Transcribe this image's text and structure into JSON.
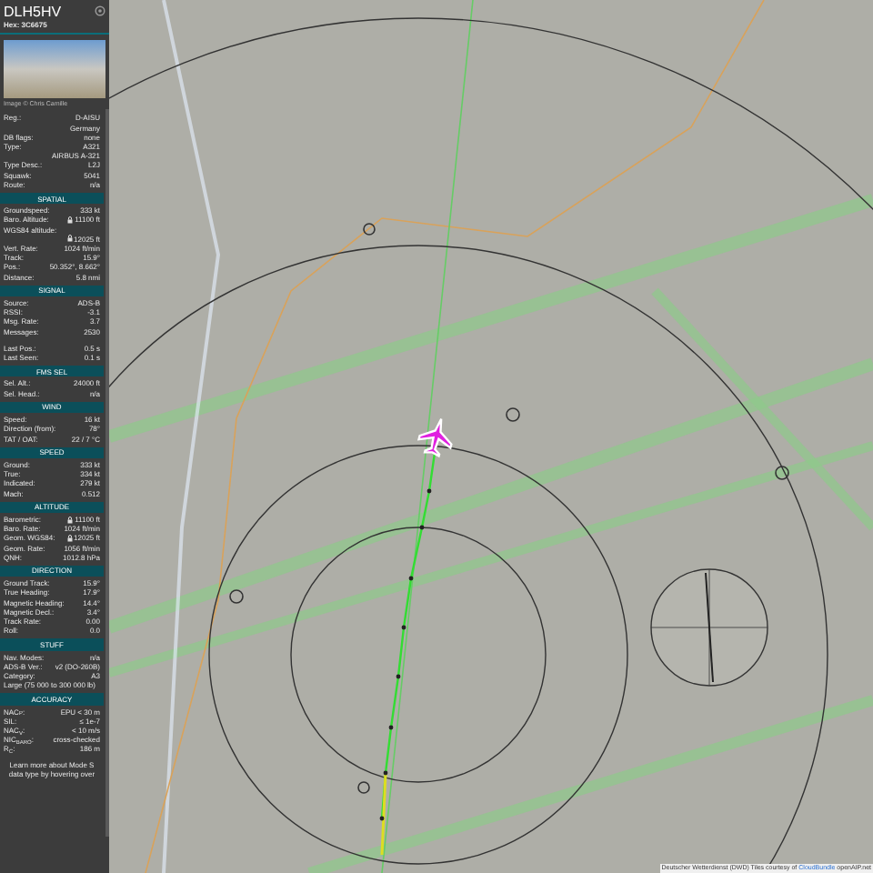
{
  "aircraft": {
    "callsign": "DLH5HV",
    "hex": "Hex: 3C6675",
    "photo_credit": "Image © Chris Camille"
  },
  "sections": [
    {
      "rows": [
        {
          "kind": "row",
          "label": "Reg.:",
          "values": [
            "D-AISU",
            "Germany"
          ]
        },
        {
          "kind": "row",
          "label": "DB flags:",
          "values": [
            "none"
          ]
        },
        {
          "kind": "row",
          "label": "Type:",
          "values": [
            "A321",
            "AIRBUS A-321"
          ]
        },
        {
          "kind": "row",
          "label": "Type Desc.:",
          "values": [
            "L2J"
          ]
        },
        {
          "kind": "row",
          "label": "Squawk:",
          "values": [
            "5041"
          ]
        },
        {
          "kind": "row",
          "label": "Route:",
          "values": [
            "n/a"
          ]
        }
      ]
    },
    {
      "title": "SPATIAL",
      "rows": [
        {
          "kind": "row",
          "label": "Groundspeed:",
          "values": [
            "333 kt"
          ]
        },
        {
          "kind": "row",
          "label": "Baro. Altitude:",
          "values": [
            "11100 ft"
          ],
          "locked": true
        },
        {
          "kind": "wrapped",
          "label": "WGS84 altitude:",
          "values": [
            "12025 ft"
          ],
          "locked": true
        },
        {
          "kind": "row",
          "label": "Vert. Rate:",
          "values": [
            "1024 ft/min"
          ]
        },
        {
          "kind": "row",
          "label": "Track:",
          "values": [
            "15.9°"
          ]
        },
        {
          "kind": "row",
          "label": "Pos.:",
          "values": [
            "50.352°, 8.662°"
          ]
        },
        {
          "kind": "row",
          "label": "Distance:",
          "values": [
            "5.8 nmi"
          ]
        }
      ]
    },
    {
      "title": "SIGNAL",
      "rows": [
        {
          "kind": "row",
          "label": "Source:",
          "values": [
            "ADS-B"
          ]
        },
        {
          "kind": "row",
          "label": "RSSI:",
          "values": [
            "-3.1"
          ]
        },
        {
          "kind": "row",
          "label": "Msg. Rate:",
          "values": [
            "3.7"
          ]
        },
        {
          "kind": "row",
          "label": "Messages:",
          "values": [
            "2530"
          ]
        },
        {
          "kind": "gap"
        },
        {
          "kind": "row",
          "label": "Last Pos.:",
          "values": [
            "0.5 s"
          ]
        },
        {
          "kind": "row",
          "label": "Last Seen:",
          "values": [
            "0.1 s"
          ]
        }
      ]
    },
    {
      "title": "FMS SEL",
      "rows": [
        {
          "kind": "row",
          "label": "Sel. Alt.:",
          "values": [
            "24000 ft"
          ]
        },
        {
          "kind": "row",
          "label": "Sel. Head.:",
          "values": [
            "n/a"
          ]
        }
      ]
    },
    {
      "title": "WIND",
      "rows": [
        {
          "kind": "row",
          "label": "Speed:",
          "values": [
            "16 kt"
          ]
        },
        {
          "kind": "row",
          "label": "Direction (from):",
          "values": [
            "78°"
          ]
        },
        {
          "kind": "row",
          "label": "TAT / OAT:",
          "values": [
            "22 / 7 °C"
          ]
        }
      ]
    },
    {
      "title": "SPEED",
      "rows": [
        {
          "kind": "row",
          "label": "Ground:",
          "values": [
            "333 kt"
          ]
        },
        {
          "kind": "row",
          "label": "True:",
          "values": [
            "334 kt"
          ]
        },
        {
          "kind": "row",
          "label": "Indicated:",
          "values": [
            "279 kt"
          ]
        },
        {
          "kind": "row",
          "label": "Mach:",
          "values": [
            "0.512"
          ]
        }
      ]
    },
    {
      "title": "ALTITUDE",
      "rows": [
        {
          "kind": "row",
          "label": "Barometric:",
          "values": [
            "11100 ft"
          ],
          "locked": true
        },
        {
          "kind": "row",
          "label": "Baro. Rate:",
          "values": [
            "1024 ft/min"
          ]
        },
        {
          "kind": "row",
          "label": "Geom. WGS84:",
          "values": [
            "12025 ft"
          ],
          "locked": true
        },
        {
          "kind": "row",
          "label": "Geom. Rate:",
          "values": [
            "1056 ft/min"
          ]
        },
        {
          "kind": "row",
          "label": "QNH:",
          "values": [
            "1012.8 hPa"
          ]
        }
      ]
    },
    {
      "title": "DIRECTION",
      "rows": [
        {
          "kind": "row",
          "label": "Ground Track:",
          "values": [
            "15.9°"
          ]
        },
        {
          "kind": "row",
          "label": "True Heading:",
          "values": [
            "17.9°"
          ]
        },
        {
          "kind": "row",
          "label": "Magnetic Heading:",
          "values": [
            "14.4°"
          ]
        },
        {
          "kind": "row",
          "label": "Magnetic Decl.:",
          "values": [
            "3.4°"
          ]
        },
        {
          "kind": "row",
          "label": "Track Rate:",
          "values": [
            "0.00"
          ]
        },
        {
          "kind": "row",
          "label": "Roll:",
          "values": [
            "0.0"
          ]
        }
      ]
    },
    {
      "title": "STUFF",
      "rows": [
        {
          "kind": "row",
          "label": "Nav. Modes:",
          "values": [
            "n/a"
          ]
        },
        {
          "kind": "row",
          "label": "ADS-B Ver.:",
          "values": [
            "v2 (DO-260B)"
          ]
        },
        {
          "kind": "row",
          "label": "Category:",
          "values": [
            "A3"
          ]
        },
        {
          "kind": "text",
          "text": "Large (75 000 to 300 000 lb)"
        }
      ]
    },
    {
      "title": "ACCURACY",
      "rows": [
        {
          "kind": "row",
          "label": "NAC$_{P}$:",
          "values": [
            "EPU < 30 m"
          ]
        },
        {
          "kind": "row",
          "label": "SIL:",
          "values": [
            "≤ 1e-7"
          ]
        },
        {
          "kind": "row",
          "label": "NAC$_{V}$:",
          "values": [
            "< 10 m/s"
          ]
        },
        {
          "kind": "row",
          "label": "NIC$_{BARO}$:",
          "values": [
            "cross-checked"
          ]
        },
        {
          "kind": "row",
          "label": "R$_{C}$:",
          "values": [
            "186 m"
          ]
        },
        {
          "kind": "note",
          "text": "Learn more about Mode S data type by hovering over"
        }
      ]
    }
  ],
  "map": {
    "attribution": "Deutscher Wetterdienst (DWD) Tiles courtesy of",
    "attribution_link": "CloudBundle",
    "attribution_end": "openAIP.net"
  }
}
